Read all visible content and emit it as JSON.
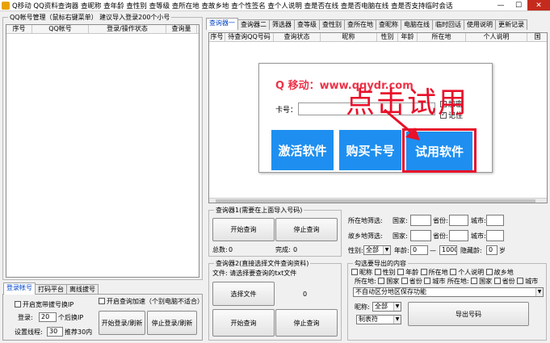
{
  "window": {
    "title": "Q移动 QQ资料查询器 查昵称 查年龄 查性别 查等级 查所在地 查故乡地 查个性签名 查个人说明 查是否在线 查是否电脑在线 查是否支持临时会话",
    "minimize": "—",
    "maximize": "☐",
    "close": "✕"
  },
  "left": {
    "group_title": "QQ帐号管理（鼠标右键菜单）  建议导入登录200个小号",
    "columns": [
      "序号",
      "QQ帐号",
      "登录/操作状态",
      "查询量"
    ],
    "tabs": [
      "登录帐号",
      "打码平台",
      "离线拔号"
    ],
    "opt_dial": "开启宽带拔号换IP",
    "opt_speed": "开启查询加速（个别电脑不适合）",
    "login_label": "登录:",
    "login_value": "20",
    "login_suffix": "个后换IP",
    "threads_label": "设置线程:",
    "threads_value": "30",
    "threads_suffix": "推荐30内",
    "start_login": "开始登录/刷新",
    "stop_login": "停止登录/刷新"
  },
  "right": {
    "tabs": [
      "查询器一",
      "查询器二",
      "筛选器",
      "查等级",
      "查性别",
      "查所在地",
      "查昵称",
      "电脑在线",
      "临时回话",
      "使用说明",
      "更新记录"
    ],
    "columns": [
      "序号",
      "待查询QQ号码",
      "查询状态",
      "昵称",
      "性别",
      "年龄",
      "所在地",
      "个人说明",
      "国"
    ],
    "q1_title": "查询器1(需要在上面导入号码)",
    "q1_start": "开始查询",
    "q1_stop": "停止查询",
    "q1_total_label": "总数:",
    "q1_total": "0",
    "q1_done_label": "完成:",
    "q1_done": "0",
    "q2_title": "查询器2(直接选择文件查询资料)",
    "q2_file_label": "文件: 请选择要查询的txt文件",
    "q2_choose": "选择文件",
    "q2_count": "0",
    "q2_start": "开始查询",
    "q2_stop": "停止查询"
  },
  "filter": {
    "loc_label": "所在地筛选:",
    "home_label": "故乡地筛选:",
    "country": "国家:",
    "province": "省份:",
    "city": "城市:",
    "gender_label": "性别:",
    "gender_value": "全部",
    "age_label": "年龄:",
    "age_from": "0",
    "age_dash": "—",
    "age_to": "1000",
    "hide_label": "隐藏龄:",
    "hide_value": "0",
    "hide_unit": "岁"
  },
  "export": {
    "title": "勾选要导出的内容",
    "row1": [
      "昵称",
      "性别",
      "年龄",
      "所在地",
      "个人说明",
      "故乡地"
    ],
    "row2": [
      "所在地:",
      "国家",
      "省份",
      "城市",
      "所在地:",
      "国家",
      "省份",
      "城市"
    ],
    "save_mode": "不自动区分地区保存功能",
    "nick_label": "昵称:",
    "nick_value": "全部",
    "table_value": "制表符",
    "export_btn": "导出号码"
  },
  "overlay": {
    "watermark": "Q 移动：www.qqydr.com",
    "headline": "点击试用",
    "card_label": "卡号：",
    "chk_encrypt": "加密",
    "chk_remember": "记住",
    "btn_activate": "激活软件",
    "btn_buy": "购买卡号",
    "btn_trial": "试用软件"
  },
  "colors": {
    "accent": "#1e8ff0",
    "alert": "#e8102a"
  }
}
